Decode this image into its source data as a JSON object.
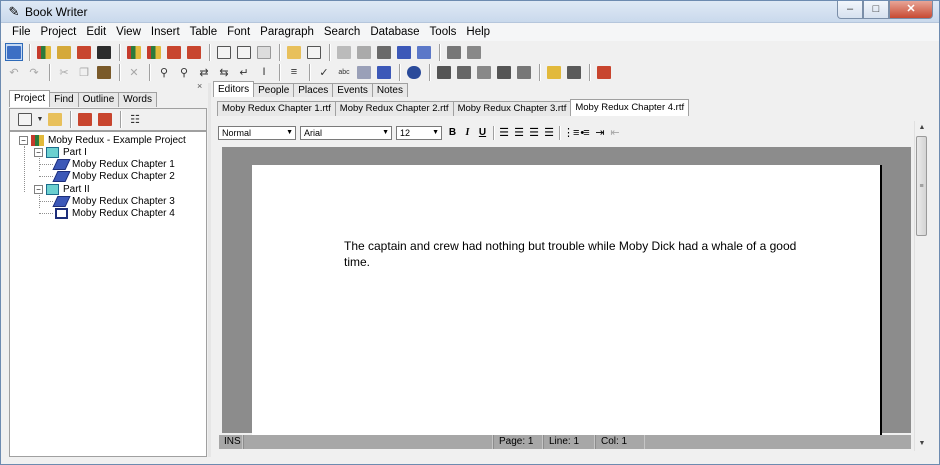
{
  "window": {
    "title": "Book Writer",
    "controls": {
      "minimize": "–",
      "maximize": "□",
      "close": "✕"
    }
  },
  "menu": [
    "File",
    "Project",
    "Edit",
    "View",
    "Insert",
    "Table",
    "Font",
    "Paragraph",
    "Search",
    "Database",
    "Tools",
    "Help"
  ],
  "left_panel": {
    "close_glyph": "×",
    "tabs": [
      "Project",
      "Find",
      "Outline",
      "Words"
    ],
    "active_tab": "Project",
    "tree": {
      "root": "Moby Redux - Example Project",
      "parts": [
        {
          "label": "Part I",
          "chapters": [
            "Moby Redux Chapter 1",
            "Moby Redux Chapter 2"
          ]
        },
        {
          "label": "Part II",
          "chapters": [
            "Moby Redux Chapter 3",
            "Moby Redux Chapter 4"
          ]
        }
      ]
    }
  },
  "editor": {
    "top_tabs": [
      "Editors",
      "People",
      "Places",
      "Events",
      "Notes"
    ],
    "active_top_tab": "Editors",
    "file_tabs": [
      "Moby Redux Chapter 1.rtf",
      "Moby Redux Chapter 2.rtf",
      "Moby Redux Chapter 3.rtf",
      "Moby Redux Chapter 4.rtf"
    ],
    "active_file_tab": "Moby Redux Chapter 4.rtf",
    "format": {
      "style": "Normal",
      "font": "Arial",
      "size": "12",
      "bold": "B",
      "italic": "I",
      "underline": "U"
    },
    "document_text": "The captain and crew had nothing but trouble while Moby Dick had a whale of a good time.",
    "status": {
      "mode": "INS",
      "page": "Page: 1",
      "line": "Line: 1",
      "col": "Col: 1"
    }
  },
  "colors": {
    "accent": "#2e6ab8",
    "page_bg": "#8c8c8c",
    "status_bg": "#a7a7a7"
  }
}
